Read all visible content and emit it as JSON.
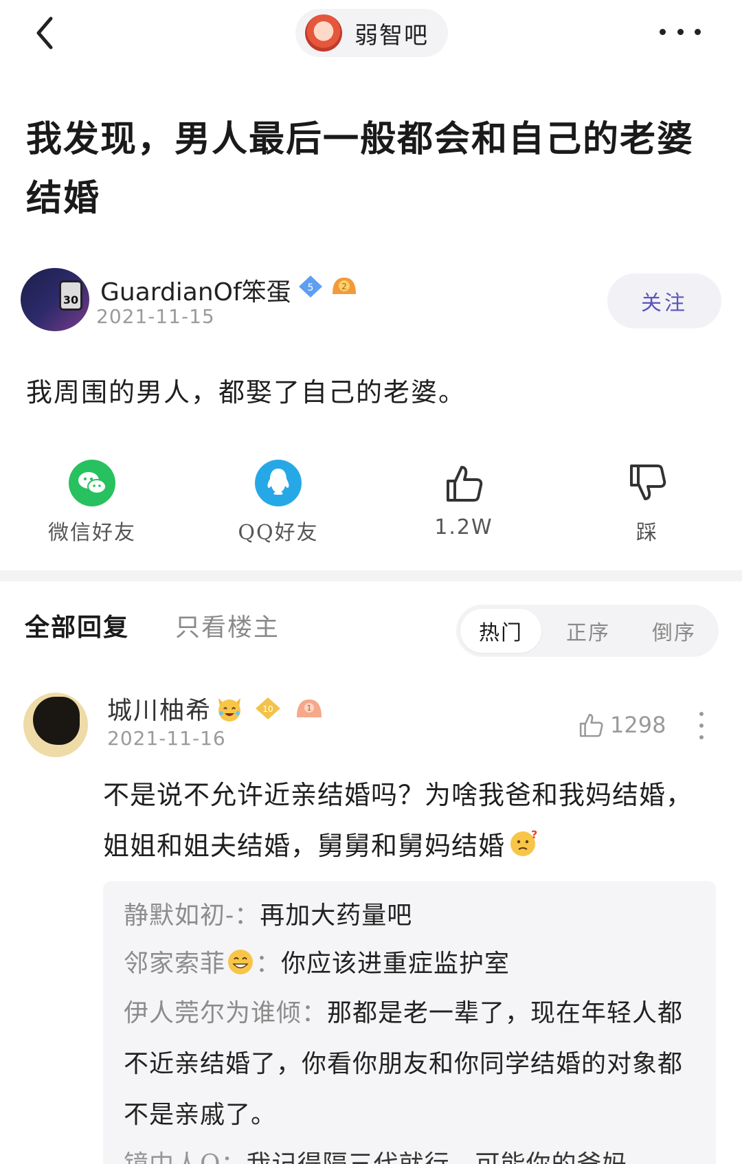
{
  "topbar": {
    "forum_name": "弱智吧"
  },
  "post": {
    "title": "我发现，男人最后一般都会和自己的老婆结婚",
    "author": {
      "name": "GuardianOf笨蛋",
      "date": "2021-11-15",
      "level": "5",
      "badge_level": "2"
    },
    "follow_label": "关注",
    "body": "我周围的男人，都娶了自己的老婆。"
  },
  "actions": {
    "wechat_label": "微信好友",
    "qq_label": "QQ好友",
    "like_count": "1.2W",
    "dislike_label": "踩"
  },
  "tabs": {
    "all_replies": "全部回复",
    "only_op": "只看楼主",
    "sort": [
      "热门",
      "正序",
      "倒序"
    ],
    "sort_active": "热门"
  },
  "comment": {
    "name": "城川柚希",
    "date": "2021-11-16",
    "level": "10",
    "badge_level": "1",
    "like_count": "1298",
    "text": "不是说不允许近亲结婚吗？为啥我爸和我妈结婚，姐姐和姐夫结婚，舅舅和舅妈结婚",
    "replies": [
      {
        "name": "静默如初-",
        "sep": "：",
        "text": "再加大药量吧"
      },
      {
        "name": "邻家索菲",
        "sep": "：",
        "text": "你应该进重症监护室"
      },
      {
        "name": "伊人莞尔为谁倾",
        "sep": "：",
        "text": "那都是老一辈了，现在年轻人都不近亲结婚了，你看你朋友和你同学结婚的对象都不是亲戚了。"
      },
      {
        "name": "镜中人Q",
        "sep": "：",
        "text": "我记得隔三代就行，可能你的爸妈"
      }
    ]
  },
  "colors": {
    "accent": "#5a56b6",
    "wechat": "#27c15f",
    "qq": "#27a8e6",
    "muted": "#9a9a9a",
    "reply_bg": "#f5f5f7"
  },
  "icons": {
    "back": "chevron-left-icon",
    "more": "more-dots-icon",
    "wechat": "wechat-icon",
    "qq": "qq-icon",
    "like": "thumbs-up-icon",
    "dislike": "thumbs-down-icon"
  }
}
